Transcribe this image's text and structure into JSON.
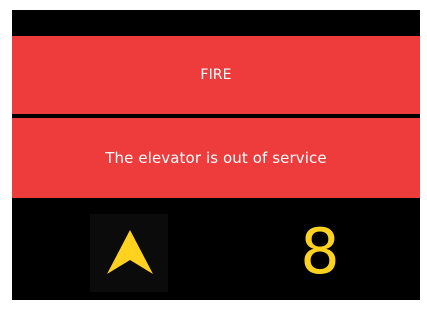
{
  "alert": {
    "title": "FIRE",
    "message": "The elevator is out of service"
  },
  "status": {
    "direction_icon": "up-arrow-icon",
    "floor": "8"
  },
  "colors": {
    "alert_background": "#ee3b3b",
    "alert_text": "#ffffff",
    "display_background": "#000000",
    "indicator": "#ffd21f"
  }
}
